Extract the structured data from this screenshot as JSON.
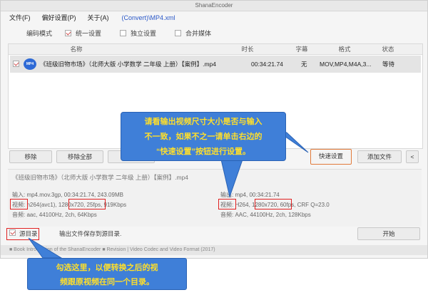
{
  "window": {
    "title": "ShanaEncoder"
  },
  "menu": {
    "items": [
      "文件(F)",
      "偏好设置(P)",
      "关于(A)"
    ],
    "path": "(Convert)\\MP4.xml"
  },
  "options": {
    "label": "编码模式",
    "unified": "统一设置",
    "independent": "独立设置",
    "merge": "合并媒体"
  },
  "table": {
    "headers": {
      "name": "名称",
      "duration": "时长",
      "subtitle": "字幕",
      "format": "格式",
      "status": "状态"
    },
    "row": {
      "icon_label": "MP4",
      "name": "《班级旧物市场》（北师大版 小学数学 二年级 上册）【案例】.mp4",
      "duration": "00:34:21.74",
      "subtitle": "无",
      "format": "MOV,MP4,M4A,3...",
      "status": "等待"
    }
  },
  "buttons": {
    "remove": "移除",
    "remove_all": "移除全部",
    "item": "项目",
    "quick_settings": "快速设置",
    "add_file": "添加文件",
    "more": "<"
  },
  "info": {
    "title": "《班级旧物市场》（北师大版 小学数学 二年级 上册）【案例】.mp4",
    "input": "输入: mp4.mov.3gp, 00:34:21.74, 243.09MB",
    "in_video": "视频: h264(avc1), 1280x720, 25fps, 919Kbps",
    "in_audio": "音频: aac, 44100Hz, 2ch, 64Kbps",
    "output": "输出: mp4, 00:34:21.74",
    "out_video": "视频: H264, 1280x720, 60fps, CRF Q=23.0",
    "out_audio": "音频: AAC, 44100Hz, 2ch, 128Kbps"
  },
  "bottom": {
    "source_dir": "源目录",
    "save_note": "输出文件保存到源目录.",
    "start": "开始"
  },
  "statusbar": {
    "text": "■ Book Introduction of the ShanaEncoder ■ Revision | Video Codec and Video Format (2017)"
  },
  "annotations": {
    "callout1": [
      "请看输出视频尺寸大小是否与输入",
      "不一致，如果不之一请单击右边的",
      "“快速设置”按钮进行设置。"
    ],
    "callout2": [
      "勾选这里，以便转换之后的视",
      "频跟原视频在同一个目录。"
    ]
  },
  "colors": {
    "callout_bg": "#3f7fd8",
    "callout_text": "#ffdf2a",
    "highlight_box": "#e02020",
    "button_highlight": "#e17a3a",
    "path_link": "#2a58c8"
  }
}
